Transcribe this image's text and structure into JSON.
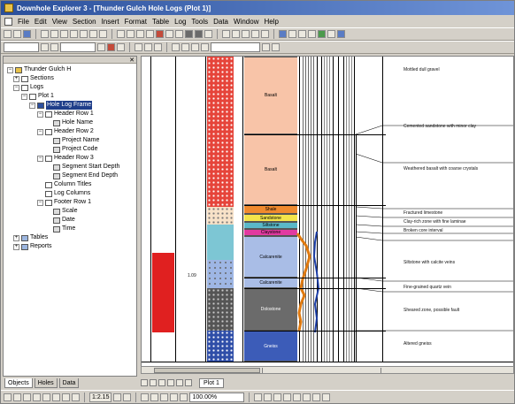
{
  "window": {
    "title": "Downhole Explorer 3 - [Thunder Gulch Hole Logs (Plot 1)]"
  },
  "menu": [
    "File",
    "Edit",
    "View",
    "Section",
    "Insert",
    "Format",
    "Table",
    "Log",
    "Tools",
    "Data",
    "Window",
    "Help"
  ],
  "tree": {
    "root": "Thunder Gulch H",
    "sections": "Sections",
    "logs": "Logs",
    "plot": "Plot 1",
    "hole_log_frame": "Hole Log Frame",
    "header_row_1": "Header Row 1",
    "hole_name": "Hole Name",
    "header_row_2": "Header Row 2",
    "project_name": "Project Name",
    "project_code": "Project Code",
    "header_row_3": "Header Row 3",
    "segment_start": "Segment Start Depth",
    "segment_end": "Segment End Depth",
    "column_titles": "Column Titles",
    "log_columns": "Log Columns",
    "footer_row_1": "Footer Row 1",
    "scale": "Scale",
    "date": "Date",
    "time": "Time",
    "tables": "Tables",
    "reports": "Reports"
  },
  "panel_tabs": [
    "Objects",
    "Holes",
    "Data"
  ],
  "doc_tab": "Plot 1",
  "status": {
    "scale": "1:2.15",
    "zoom": "100.00%"
  },
  "log": {
    "cell_number": "1.09",
    "units": [
      {
        "label": "Basalt",
        "color": "#f8c4a8"
      },
      {
        "label": "Basalt",
        "color": "#f8c4a8"
      },
      {
        "label": "Shale",
        "color": "#f08a2e"
      },
      {
        "label": "Sandstone",
        "color": "#f4e44a"
      },
      {
        "label": "Siltstone",
        "color": "#5ab8c8"
      },
      {
        "label": "Claystone",
        "color": "#e23aa0"
      },
      {
        "label": "Calcarenite",
        "color": "#a9bde6"
      },
      {
        "label": "Calcarenite",
        "color": "#a9bde6"
      },
      {
        "label": "Dolostone",
        "color": "#6b6b6b"
      },
      {
        "label": "Gneiss",
        "color": "#3c5cb8"
      }
    ],
    "notes": [
      "Mottled dull gravel",
      "Cemented sandstone with minor clay",
      "Weathered basalt with coarse crystals",
      "Fractured limestone",
      "Clay-rich zone with fine laminae",
      "Broken core interval",
      "Siltstone with calcite veins",
      "Fine-grained quartz vein",
      "Sheared zone, possible fault",
      "Altered gneiss"
    ]
  }
}
